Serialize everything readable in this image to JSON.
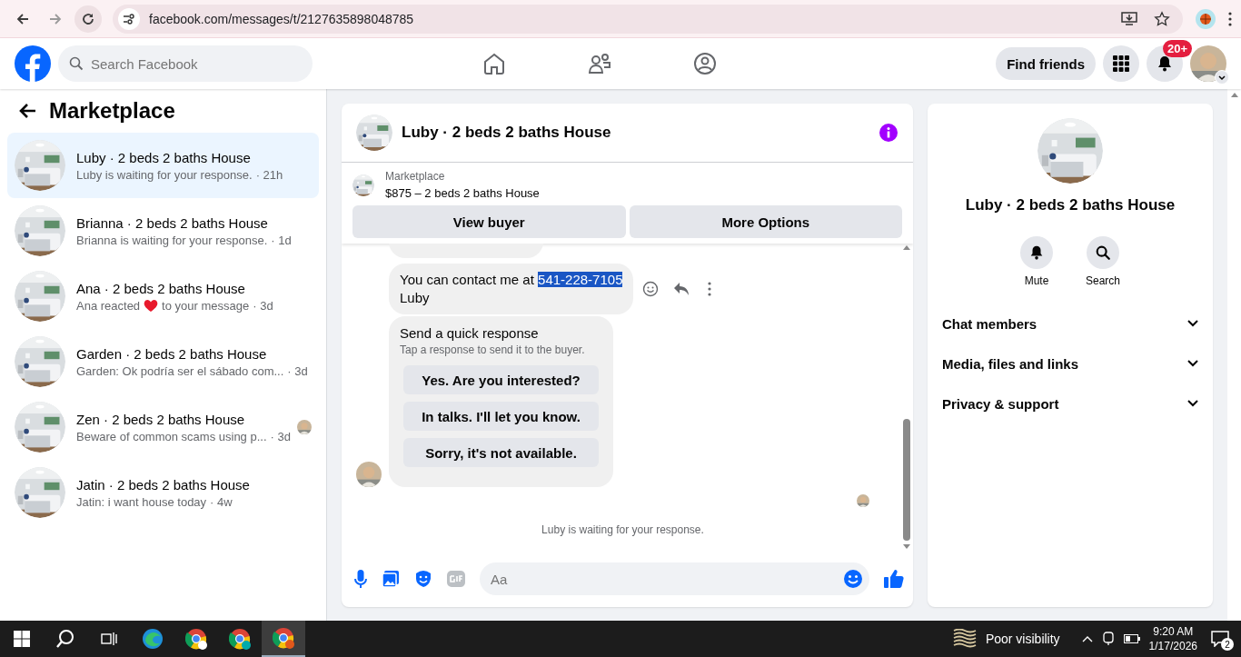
{
  "browser": {
    "url": "facebook.com/messages/t/2127635898048785"
  },
  "topbar": {
    "search": {
      "placeholder": "Search Facebook"
    },
    "find_friends": "Find friends",
    "notification_badge": "20+"
  },
  "sidebar": {
    "title": "Marketplace",
    "conversations": [
      {
        "title": "Luby · 2 beds 2 baths House",
        "preview": "Luby is waiting for your response.",
        "time": "· 21h",
        "selected": true,
        "seen": false
      },
      {
        "title": "Brianna · 2 beds 2 baths House",
        "preview": "Brianna is waiting for your response.",
        "time": "· 1d",
        "selected": false,
        "seen": false
      },
      {
        "title": "Ana · 2 beds 2 baths House",
        "preview": "Ana reacted",
        "preview_after": "to your message",
        "time": "· 3d",
        "selected": false,
        "seen": false
      },
      {
        "title": "Garden · 2 beds 2 baths House",
        "preview": "Garden: Ok podría ser el sábado com...",
        "time": "· 3d",
        "selected": false,
        "seen": false
      },
      {
        "title": "Zen · 2 beds 2 baths House",
        "preview": "Beware of common scams using p...",
        "time": "· 3d",
        "selected": false,
        "seen": true
      },
      {
        "title": "Jatin · 2 beds 2 baths House",
        "preview": "Jatin: i want house today",
        "time": "· 4w",
        "selected": false,
        "seen": false
      }
    ]
  },
  "chat": {
    "title": "Luby · 2 beds 2 baths House",
    "listing": {
      "label": "Marketplace",
      "title": "$875 – 2 beds 2 baths House"
    },
    "buttons": [
      "View buyer",
      "More Options"
    ],
    "message": {
      "lines": [
        [
          {
            "text": "You can contact me at",
            "selected": false
          },
          {
            "text": "541-228-7105",
            "selected": true
          }
        ],
        [
          {
            "text": "Luby",
            "selected": false
          }
        ]
      ]
    },
    "quick_response": {
      "title": "Send a quick response",
      "subtitle": "Tap a response to send it to the buyer.",
      "options": [
        "Yes. Are you interested?",
        "In talks. I'll let you know.",
        "Sorry, it's not available."
      ]
    },
    "status": "Luby is waiting for your response.",
    "composer": {
      "placeholder": "Aa"
    }
  },
  "details": {
    "title": "Luby · 2 beds 2 baths House",
    "actions": [
      {
        "label": "Mute",
        "kind": "mute"
      },
      {
        "label": "Search",
        "kind": "search"
      }
    ],
    "sections": [
      {
        "label": "Chat members",
        "expanded": false
      },
      {
        "label": "Media, files and links",
        "expanded": false
      },
      {
        "label": "Privacy & support",
        "expanded": false
      }
    ]
  },
  "taskbar": {
    "weather": "Poor visibility",
    "time": "9:20 AM",
    "date": "1/17/2026",
    "notifications": "2"
  }
}
